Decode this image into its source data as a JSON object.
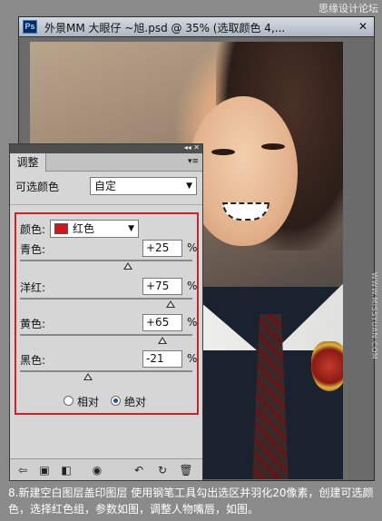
{
  "watermark": {
    "top": "思缘设计论坛",
    "side": "WWW.MISSYUAN.COM"
  },
  "doc": {
    "app_badge": "Ps",
    "title": "外景MM 大眼仔 ~旭.psd @ 35% (选取颜色 4,...",
    "close": "✕"
  },
  "panel": {
    "tab": "调整",
    "controls": "◂◂ ✕",
    "menu": "▾≡",
    "preset_label": "可选颜色",
    "preset_value": "自定",
    "colors_label": "颜色:",
    "colors_value": "红色",
    "swatch_color": "#d4161c",
    "sliders": [
      {
        "label": "青色:",
        "value": "+25",
        "unit": "%",
        "level": 0.625
      },
      {
        "label": "洋红:",
        "value": "+75",
        "unit": "%",
        "level": 0.875
      },
      {
        "label": "黄色:",
        "value": "+65",
        "unit": "%",
        "level": 0.825
      },
      {
        "label": "黑色:",
        "value": "-21",
        "unit": "%",
        "level": 0.395
      }
    ],
    "method": {
      "relative": "相对",
      "absolute": "绝对",
      "selected": "absolute"
    }
  },
  "footer_icons": [
    "back-arrow-icon",
    "new-layer-icon",
    "clip-icon",
    "visibility-icon",
    "previous-state-icon",
    "reset-icon",
    "trash-icon"
  ],
  "caption": "8.新建空白图层盖印图层 使用钢笔工具勾出选区并羽化20像素，创建可选颜色，选择红色组，参数如图，调整人物嘴唇，如图。"
}
